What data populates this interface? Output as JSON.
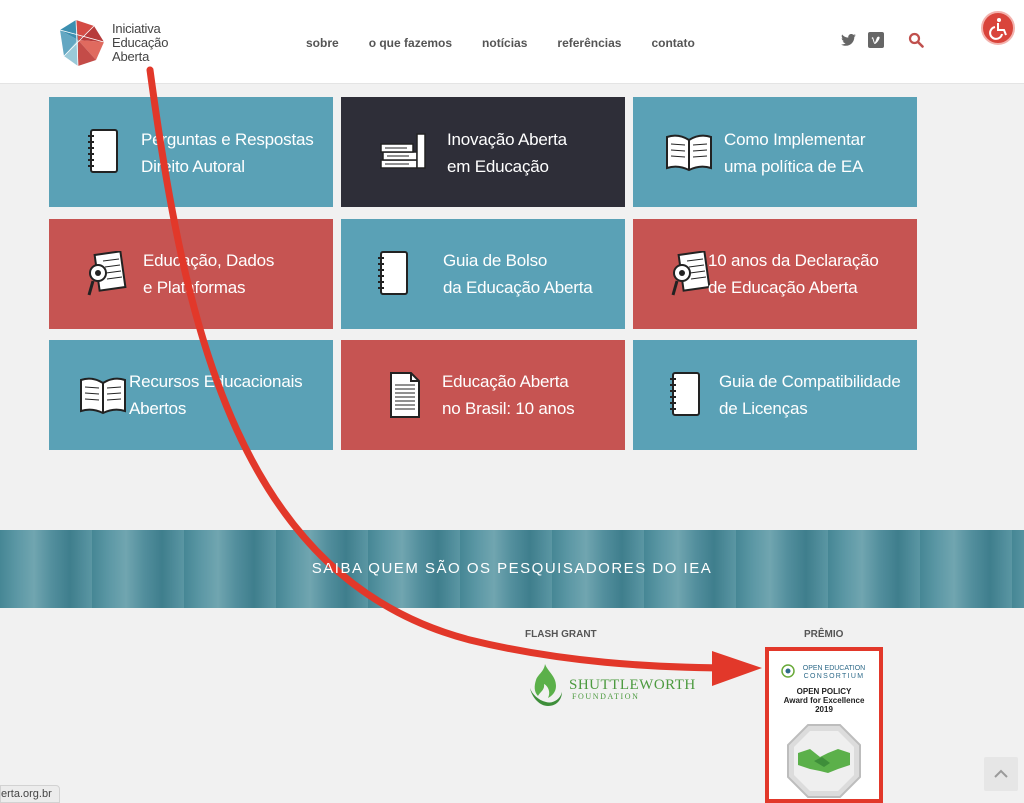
{
  "logo": {
    "line1": "Iniciativa",
    "line2": "Educação Aberta"
  },
  "nav": {
    "items": [
      "sobre",
      "o que fazemos",
      "notícias",
      "referências",
      "contato"
    ]
  },
  "tiles": [
    {
      "lines": [
        "Perguntas e Respostas",
        "Direito Autoral"
      ],
      "color": "#5aa1b6",
      "icon": "notebook-icon"
    },
    {
      "lines": [
        "Inovação Aberta",
        "em Educação"
      ],
      "color": "#2e2e38",
      "icon": "books-icon"
    },
    {
      "lines": [
        "Como Implementar",
        "uma política de EA"
      ],
      "color": "#5aa1b6",
      "icon": "open-book-icon"
    },
    {
      "lines": [
        "Educação, Dados",
        "e Plataformas"
      ],
      "color": "#c65452",
      "icon": "document-magnifier-icon"
    },
    {
      "lines": [
        "Guia de Bolso",
        "da Educação Aberta"
      ],
      "color": "#5aa1b6",
      "icon": "notebook-icon"
    },
    {
      "lines": [
        "10 anos da Declaração",
        "de Educação Aberta"
      ],
      "color": "#c65452",
      "icon": "document-magnifier-icon"
    },
    {
      "lines": [
        "Recursos Educacionais",
        "Abertos"
      ],
      "color": "#5aa1b6",
      "icon": "open-book-icon"
    },
    {
      "lines": [
        "Educação Aberta",
        "no Brasil: 10 anos"
      ],
      "color": "#c65452",
      "icon": "document-icon"
    },
    {
      "lines": [
        "Guia de Compatibilidade",
        "de Licenças"
      ],
      "color": "#5aa1b6",
      "icon": "notebook-icon"
    }
  ],
  "banner": {
    "text": "SAIBA QUEM SÃO OS PESQUISADORES DO IEA"
  },
  "flash_grant": {
    "caption": "FLASH GRANT",
    "name": "SHUTTLEWORTH",
    "sub": "FOUNDATION"
  },
  "premio": {
    "caption": "PRÊMIO",
    "org_line1": "OPEN EDUCATION",
    "org_line2": "CONSORTIUM",
    "title_line1": "OPEN POLICY",
    "title_line2": "Award for Excellence",
    "title_line3": "2019"
  },
  "status_bar": {
    "url": "erta.org.br"
  },
  "colors": {
    "teal": "#5aa1b6",
    "red": "#c65452",
    "dark": "#2e2e38",
    "annotation": "#e2382a"
  }
}
